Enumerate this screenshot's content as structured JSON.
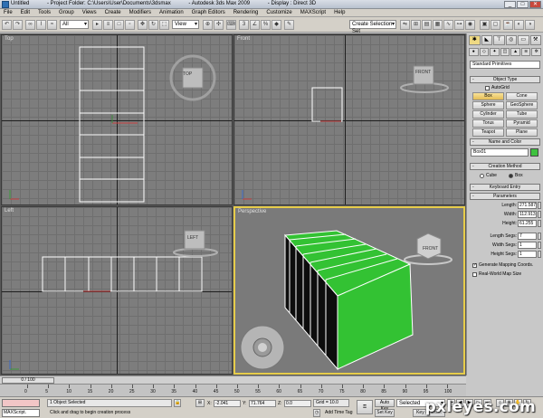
{
  "window": {
    "doc_name": "Untitled",
    "project_folder": "- Project Folder: C:\\Users\\User\\Documents\\3dsmax",
    "app_name": "- Autodesk 3ds Max 2009",
    "display_mode": "- Display : Direct 3D",
    "controls": [
      "_",
      "□",
      "✕"
    ]
  },
  "menubar": [
    "File",
    "Edit",
    "Tools",
    "Group",
    "Views",
    "Create",
    "Modifiers",
    "Animation",
    "Graph Editors",
    "Rendering",
    "Customize",
    "MAXScript",
    "Help"
  ],
  "toolbar": {
    "selection_filter": "All",
    "reference_coord": "View",
    "named_selection": "Create Selection Set"
  },
  "viewports": {
    "top": {
      "label": "Top",
      "cube": "TOP"
    },
    "front": {
      "label": "Front",
      "cube": "FRONT"
    },
    "left": {
      "label": "Left",
      "cube": "LEFT"
    },
    "perspective": {
      "label": "Perspective",
      "cube": "FRONT"
    }
  },
  "command_panel": {
    "category": "Standard Primitives",
    "object_type_header": "Object Type",
    "autogrid": "AutoGrid",
    "objects": [
      "Box",
      "Cone",
      "Sphere",
      "GeoSphere",
      "Cylinder",
      "Tube",
      "Torus",
      "Pyramid",
      "Teapot",
      "Plane"
    ],
    "selected_object": "Box",
    "name_color_header": "Name and Color",
    "object_name": "Box01",
    "object_color": "#3fc23f",
    "creation_method_header": "Creation Method",
    "creation_methods": [
      "Cube",
      "Box"
    ],
    "creation_selected": "Box",
    "keyboard_entry_header": "Keyboard Entry",
    "parameters_header": "Parameters",
    "params": [
      {
        "label": "Length:",
        "value": "271.587"
      },
      {
        "label": "Width:",
        "value": "112.913"
      },
      {
        "label": "Height:",
        "value": "61.255"
      },
      {
        "label": "Length Segs:",
        "value": "7"
      },
      {
        "label": "Width Segs:",
        "value": "1"
      },
      {
        "label": "Height Segs:",
        "value": "1"
      }
    ],
    "generate_mapping": "Generate Mapping Coords.",
    "real_world": "Real-World Map Size"
  },
  "timeline": {
    "frame": "0 / 100",
    "ticks": [
      "0",
      "5",
      "10",
      "15",
      "20",
      "25",
      "30",
      "35",
      "40",
      "45",
      "50",
      "55",
      "60",
      "65",
      "70",
      "75",
      "80",
      "85",
      "90",
      "95",
      "100"
    ]
  },
  "status": {
    "maxscript": "MAXScript.",
    "selection": "1 Object Selected",
    "prompt": "Click and drag to begin creation process",
    "x_label": "X:",
    "x": "-2.041",
    "y_label": "Y:",
    "y": "71.764",
    "z_label": "Z:",
    "z": "0.0",
    "grid": "Grid = 10.0",
    "add_time_tag": "Add Time Tag",
    "auto_key": "Auto Key",
    "set_key": "Set Key",
    "selected": "Selected",
    "key_filters": "Key Filters..."
  },
  "watermark": "pxleyes.com"
}
